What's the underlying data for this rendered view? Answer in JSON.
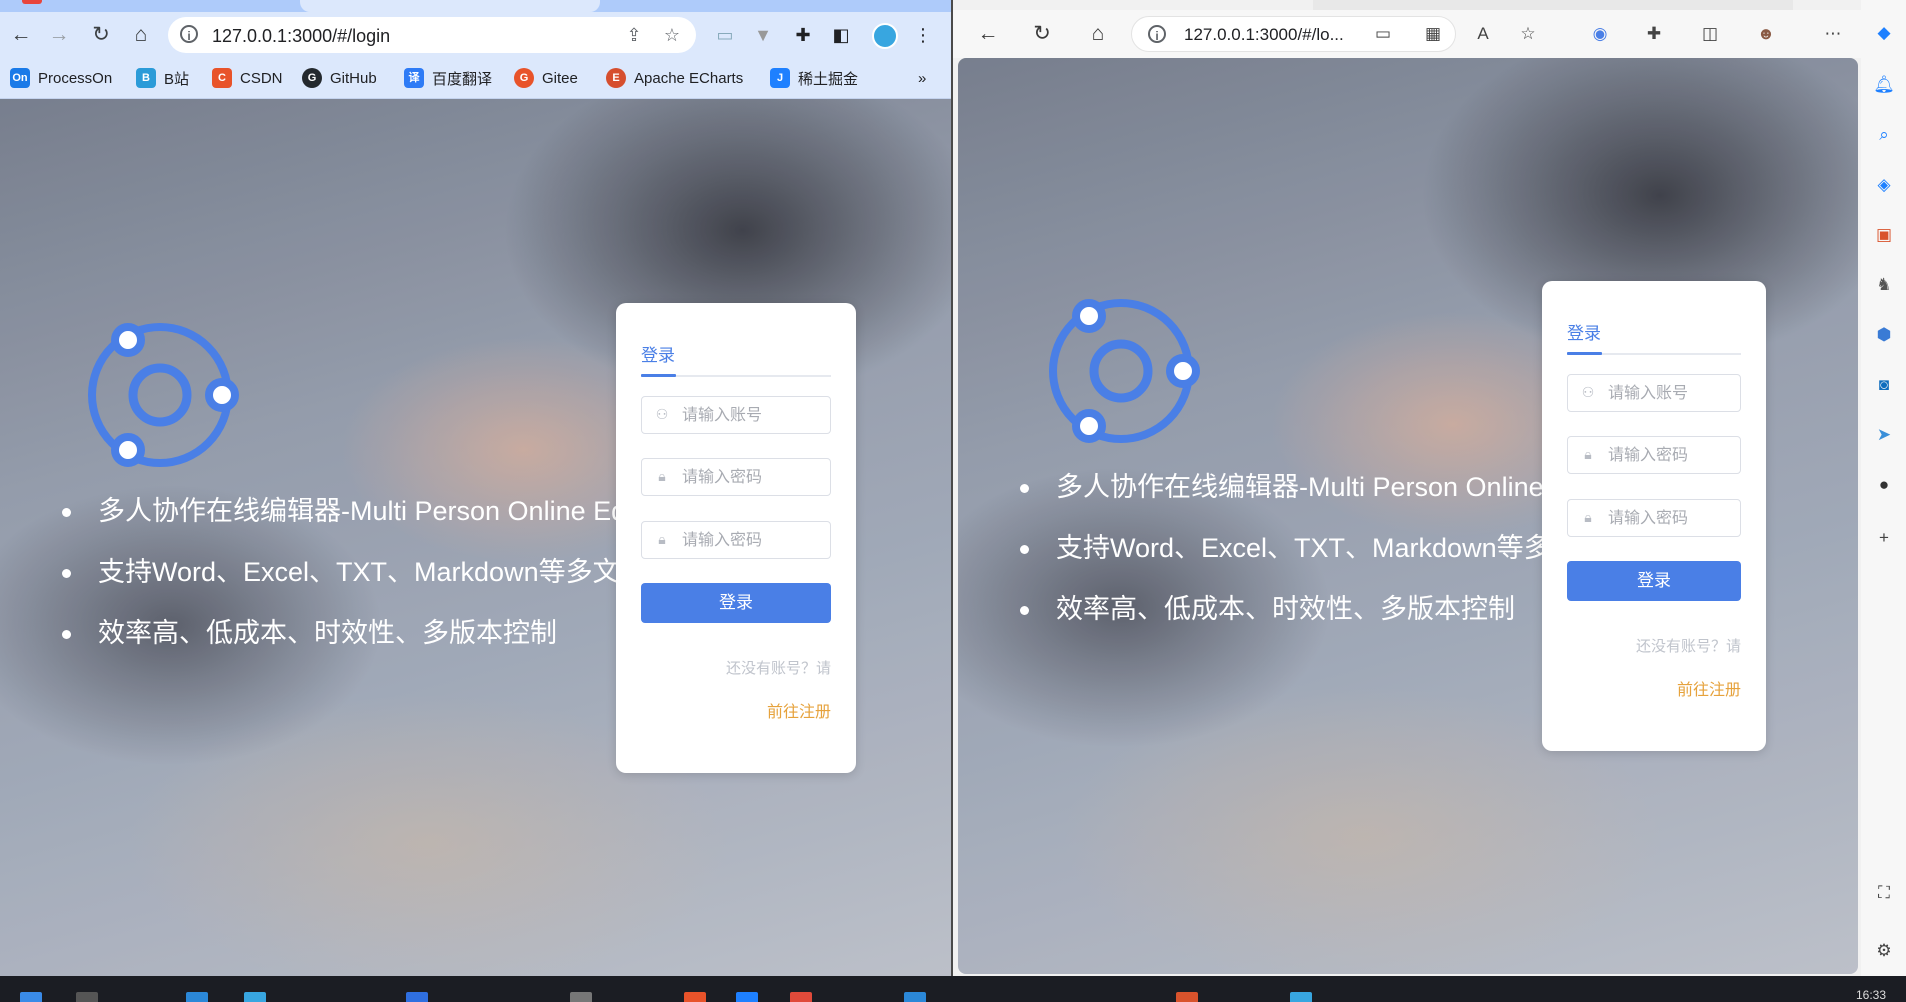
{
  "left_window": {
    "address": "127.0.0.1:3000/#/login",
    "bookmarks": [
      {
        "label": "ProcessOn",
        "icon": "On",
        "color": "#1a7ae8"
      },
      {
        "label": "B站",
        "icon": "B",
        "color": "#2b9bd8"
      },
      {
        "label": "CSDN",
        "icon": "C",
        "color": "#e8532a"
      },
      {
        "label": "GitHub",
        "icon": "G",
        "color": "#24292e"
      },
      {
        "label": "百度翻译",
        "icon": "译",
        "color": "#2e7bf6"
      },
      {
        "label": "Gitee",
        "icon": "G",
        "color": "#e8532a"
      },
      {
        "label": "Apache ECharts",
        "icon": "E",
        "color": "#d64e2e"
      },
      {
        "label": "稀土掘金",
        "icon": "J",
        "color": "#1e80ff"
      }
    ],
    "bookmarks_overflow": "»"
  },
  "right_window": {
    "address": "127.0.0.1:3000/#/lo..."
  },
  "page": {
    "bullets": [
      "多人协作在线编辑器-Multi Person Online Editor",
      "支持Word、Excel、TXT、Markdown等多文件格式",
      "效率高、低成本、时效性、多版本控制"
    ],
    "login_card": {
      "tab_label": "登录",
      "account_placeholder": "请输入账号",
      "password_placeholder": "请输入密码",
      "confirm_placeholder": "请输入密码",
      "login_button": "登录",
      "no_account_text": "还没有账号？请",
      "register_link": "前往注册"
    }
  },
  "colors": {
    "accent": "#4a7fe6",
    "link_orange": "#e6a23c",
    "chrome_frame": "#dce8fc"
  },
  "taskbar": {
    "time": "16:33"
  }
}
